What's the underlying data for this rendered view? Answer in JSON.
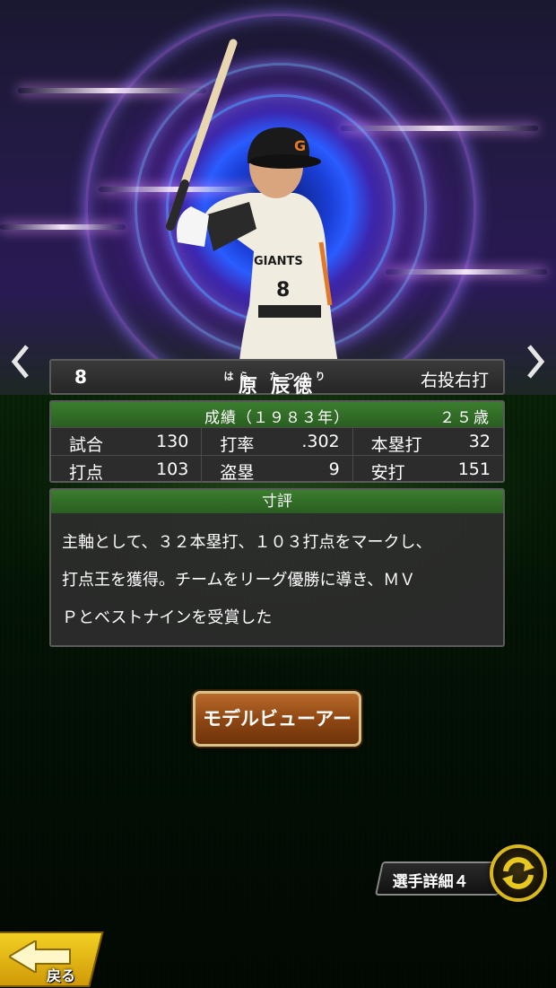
{
  "player": {
    "number": "8",
    "name": "原 辰徳",
    "ruby": "はら　たつのり",
    "handedness": "右投右打"
  },
  "stats": {
    "header": "成績（１９８３年）",
    "age": "２５歳",
    "rows": [
      [
        {
          "label": "試合",
          "value": "130"
        },
        {
          "label": "打率",
          "value": ".302"
        },
        {
          "label": "本塁打",
          "value": "32"
        }
      ],
      [
        {
          "label": "打点",
          "value": "103"
        },
        {
          "label": "盗塁",
          "value": "9"
        },
        {
          "label": "安打",
          "value": "151"
        }
      ]
    ]
  },
  "evaluation": {
    "header": "寸評",
    "lines": [
      "主軸として、３２本塁打、１０３打点をマークし、",
      "打点王を獲得。チームをリーグ優勝に導き、ＭＶ",
      "Ｐとベストナインを受賞した"
    ]
  },
  "buttons": {
    "model_viewer": "モデルビューアー",
    "detail": "選手詳細４",
    "back": "戻る"
  },
  "icons": {
    "prev": "chevron-left-icon",
    "next": "chevron-right-icon",
    "swap": "swap-arrows-icon",
    "back": "back-arrow-icon"
  },
  "colors": {
    "header_green": "#2f6a25",
    "button_brown": "#8c4512",
    "swap_gold": "#d9b81c",
    "back_yellow": "#f2d023"
  },
  "uniform_text": {
    "cap_logo": "G",
    "jersey_name": "GIANTS",
    "jersey_number": "8"
  }
}
